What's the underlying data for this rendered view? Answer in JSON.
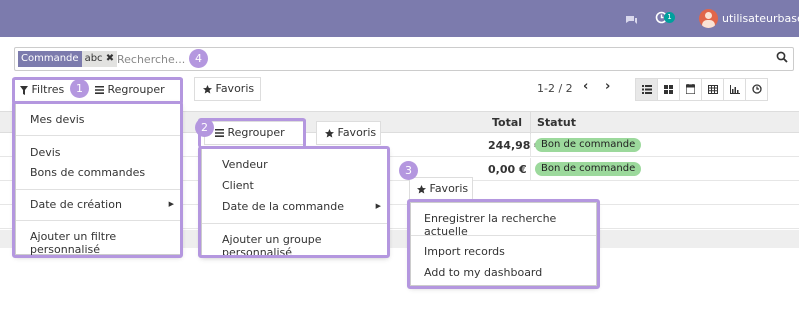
{
  "topbar": {
    "chat_icon": "chat-icon",
    "activity_icon": "clock-icon",
    "activity_count": "1",
    "username": "utilisateurbase",
    "bg_color": "#7c7bad"
  },
  "search": {
    "facet_key": "Commande",
    "facet_value": "abc",
    "facet_remove": "✖",
    "placeholder": "Recherche..."
  },
  "toolbar": {
    "filters_label": "Filtres",
    "group_label": "Regrouper par",
    "fav_label": "Favoris",
    "pager": "1-2 / 2"
  },
  "table": {
    "headers": {
      "total": "Total",
      "statut": "Statut"
    },
    "rows": [
      {
        "total": "244,98 €",
        "statut": "Bon de commande"
      },
      {
        "total": "0,00 €",
        "statut": "Bon de commande"
      }
    ]
  },
  "filters_menu": {
    "items": [
      "Mes devis",
      "Devis",
      "Bons de commandes",
      "Date de création",
      "Ajouter un filtre personnalisé"
    ]
  },
  "group_menu": {
    "button_label": "Regrouper par",
    "fav_label": "Favoris",
    "items": [
      "Vendeur",
      "Client",
      "Date de la commande",
      "Ajouter un groupe personnalisé"
    ]
  },
  "fav_menu": {
    "button_label": "Favoris",
    "items": [
      "Enregistrer la recherche actuelle",
      "Import records",
      "Add to my dashboard"
    ]
  },
  "callouts": [
    "1",
    "2",
    "3",
    "4"
  ],
  "colors": {
    "highlight": "#b497df",
    "badge": "#9cd99c",
    "facet": "#7c7bad"
  }
}
